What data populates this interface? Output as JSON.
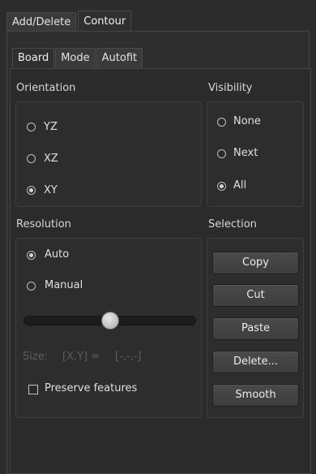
{
  "top_tabs": [
    "Add/Delete",
    "Contour"
  ],
  "sub_tabs": [
    "Board",
    "Mode",
    "Autofit"
  ],
  "orientation": {
    "title": "Orientation",
    "options": [
      "YZ",
      "XZ",
      "XY"
    ],
    "selected": "XY"
  },
  "visibility": {
    "title": "Visibility",
    "options": [
      "None",
      "Next",
      "All"
    ],
    "selected": "All"
  },
  "resolution": {
    "title": "Resolution",
    "options": [
      "Auto",
      "Manual"
    ],
    "selected": "Auto",
    "slider_fraction": 0.5,
    "size_label": "Size:",
    "size_expr": "[X,Y] =",
    "size_value": "[-,-,-]",
    "preserve_label": "Preserve features",
    "preserve_checked": false
  },
  "selection": {
    "title": "Selection",
    "buttons": [
      "Copy",
      "Cut",
      "Paste",
      "Delete...",
      "Smooth"
    ]
  }
}
